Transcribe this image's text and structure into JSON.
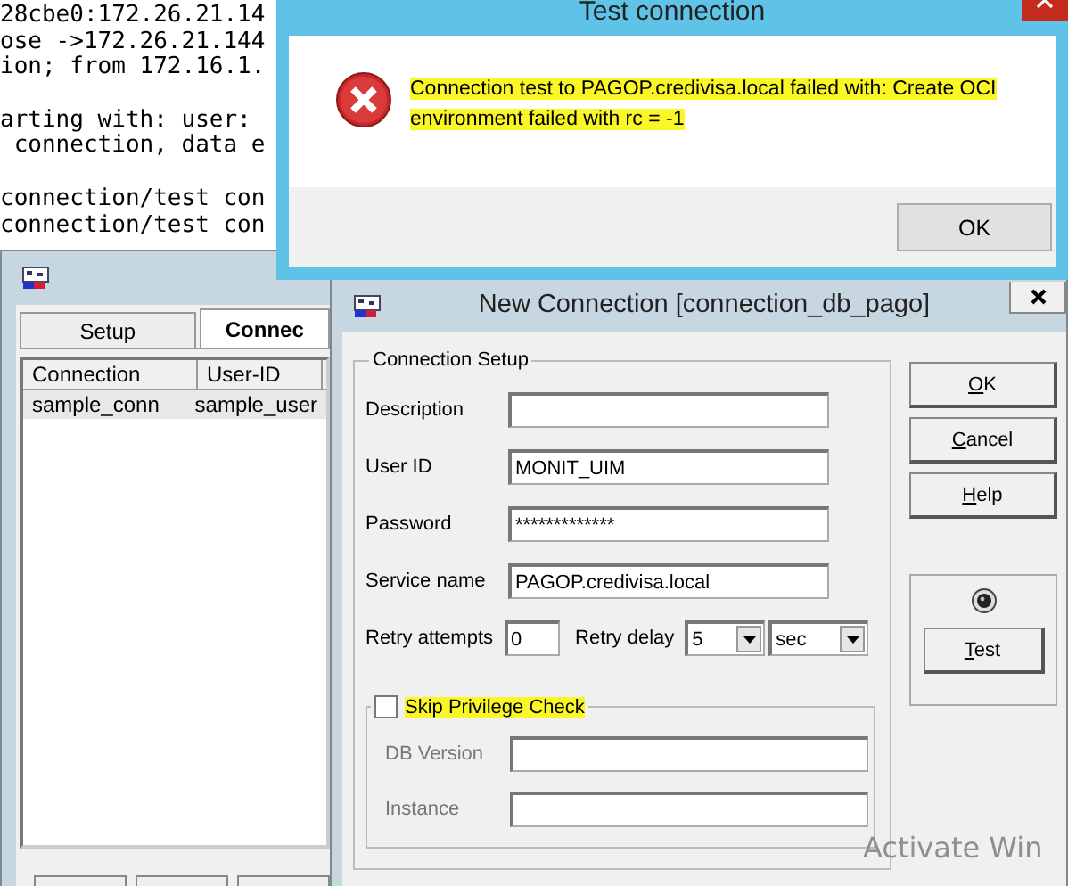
{
  "console": {
    "blocks": [
      [
        "28cbe0:172.26.21.14",
        "ose ->172.26.21.144",
        "ion; from 172.16.1."
      ],
      [
        "arting with: user:",
        " connection, data e"
      ],
      [
        "connection/test con",
        "connection/test con"
      ]
    ]
  },
  "main_window": {
    "tabs": [
      {
        "label": "Setup",
        "selected": false
      },
      {
        "label": "Connec",
        "selected": true
      }
    ],
    "columns": [
      "Connection",
      "User-ID"
    ],
    "rows": [
      {
        "cells": [
          "sample_conn",
          "sample_user"
        ],
        "selected": true
      }
    ]
  },
  "new_connection": {
    "title": "New Connection [connection_db_pago]",
    "group_title": "Connection Setup",
    "fields": [
      {
        "label": "Description"
      },
      {
        "label": "User ID",
        "value": "MONIT_UIM"
      },
      {
        "label": "Password",
        "value": "*************"
      },
      {
        "label": "Service name",
        "value": "PAGOP.credivisa.local"
      }
    ],
    "retry": {
      "attempts_label": "Retry attempts",
      "attempts": "0",
      "delay_label": "Retry delay",
      "delay": "5",
      "unit": "sec"
    },
    "skip_privilege": {
      "label": "Skip Privilege Check",
      "checked": false,
      "highlighted": true
    },
    "privilege_fields": [
      {
        "label": "DB Version",
        "disabled": true
      },
      {
        "label": "Instance",
        "disabled": true
      }
    ],
    "buttons": [
      {
        "label": "OK",
        "mnemonic": true
      },
      {
        "label": "Cancel",
        "mnemonic": true
      },
      {
        "label": "Help",
        "mnemonic": true
      }
    ],
    "test_button": {
      "label": "Test",
      "mnemonic": true
    }
  },
  "test_dialog": {
    "title": "Test connection",
    "message": "Connection test to PAGOP.credivisa.local failed with: Create OCI environment failed with rc = -1",
    "highlighted": true,
    "button": "OK"
  },
  "os_notice": "Activate Win"
}
